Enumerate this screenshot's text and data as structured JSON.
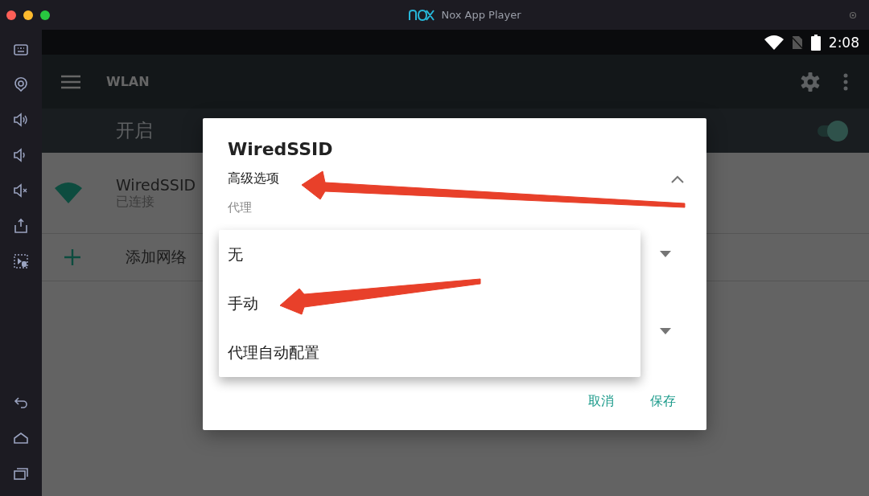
{
  "window": {
    "title": "Nox App Player"
  },
  "status_bar": {
    "time": "2:08"
  },
  "toolbar": {
    "title": "WLAN"
  },
  "master_switch": {
    "label": "开启",
    "on": true
  },
  "networks": [
    {
      "name": "WiredSSID",
      "status": "已连接"
    }
  ],
  "add_network": {
    "label": "添加网络"
  },
  "dialog": {
    "title": "WiredSSID",
    "advanced": {
      "label": "高级选项",
      "expanded": true
    },
    "proxy_label": "代理",
    "proxy_menu": [
      {
        "label": "无",
        "selected": false
      },
      {
        "label": "手动",
        "selected": false
      },
      {
        "label": "代理自动配置",
        "selected": false
      }
    ],
    "buttons": [
      {
        "label": "取消"
      },
      {
        "label": "保存"
      }
    ]
  }
}
